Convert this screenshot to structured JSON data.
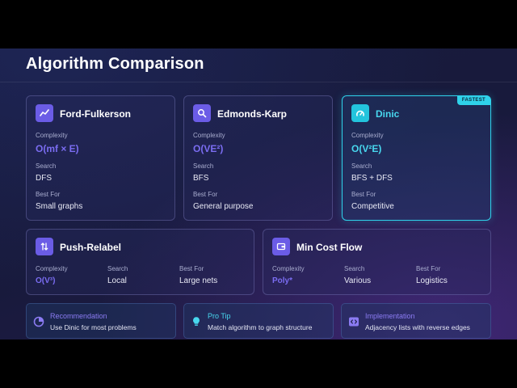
{
  "header": {
    "title": "Algorithm Comparison"
  },
  "labels": {
    "complexity": "Complexity",
    "search": "Search",
    "best_for": "Best For"
  },
  "algorithms": [
    {
      "name": "Ford-Fulkerson",
      "complexity": "O(mf × E)",
      "search": "DFS",
      "best_for": "Small graphs",
      "icon": "trend-line-icon"
    },
    {
      "name": "Edmonds-Karp",
      "complexity": "O(VE²)",
      "search": "BFS",
      "best_for": "General purpose",
      "icon": "search-icon"
    },
    {
      "name": "Dinic",
      "complexity": "O(V²E)",
      "search": "BFS + DFS",
      "best_for": "Competitive",
      "icon": "speedometer-icon",
      "badge": "FASTEST"
    },
    {
      "name": "Push-Relabel",
      "complexity": "O(V³)",
      "search": "Local",
      "best_for": "Large nets",
      "icon": "up-down-arrows-icon"
    },
    {
      "name": "Min Cost Flow",
      "complexity": "Poly*",
      "search": "Various",
      "best_for": "Logistics",
      "icon": "wallet-icon"
    }
  ],
  "tips": [
    {
      "title": "Recommendation",
      "text": "Use Dinic for most problems",
      "icon": "pie-chart-icon"
    },
    {
      "title": "Pro Tip",
      "text": "Match algorithm to graph structure",
      "icon": "lightbulb-icon"
    },
    {
      "title": "Implementation",
      "text": "Adjacency lists with reverse edges",
      "icon": "code-icon"
    }
  ],
  "colors": {
    "accent_purple": "#6b5ce6",
    "accent_cyan": "#2fd2ea",
    "background": "#181a3c"
  }
}
